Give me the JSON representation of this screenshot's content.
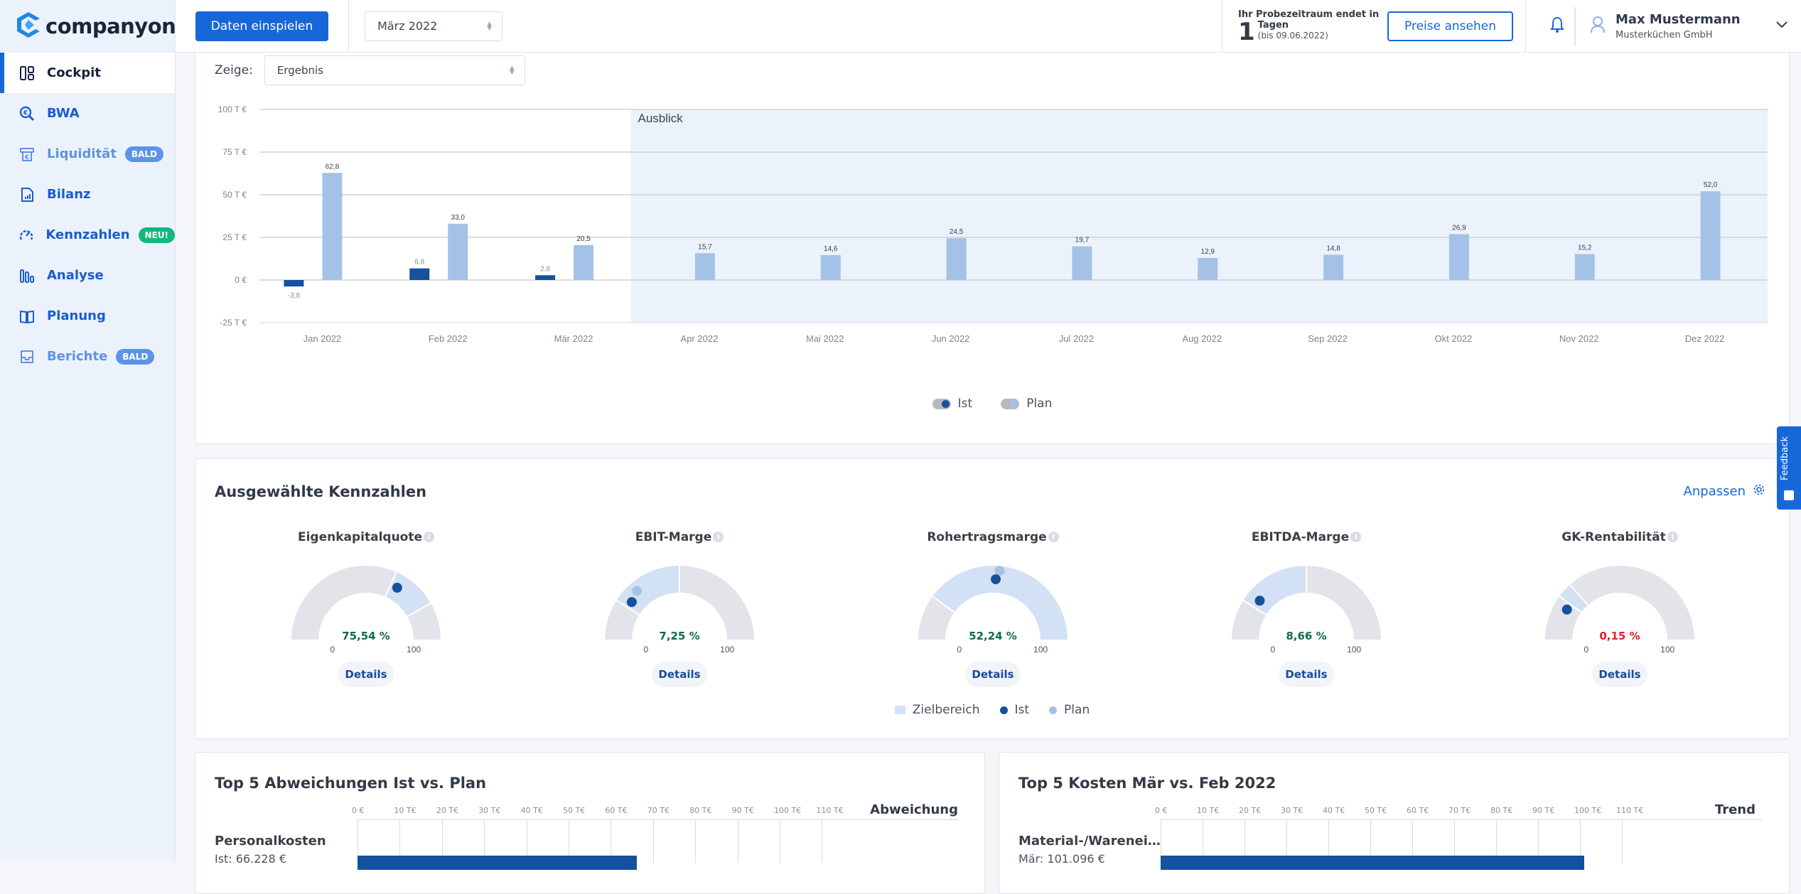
{
  "app": {
    "brand": "companyon",
    "colors": {
      "accent": "#1767d9",
      "ist": "#14519e",
      "plan": "#a4c2e8",
      "zielbereich": "#d3e1f4",
      "track": "#e3e4e9",
      "ok": "#116b49",
      "bad": "#e21d2c",
      "neu": "#12b77c",
      "bald": "#5d93e8"
    }
  },
  "sidebar": {
    "items": [
      {
        "label": "Cockpit",
        "icon": "dashboard-icon",
        "active": true
      },
      {
        "label": "BWA",
        "icon": "euro-search-icon"
      },
      {
        "label": "Liquidität",
        "icon": "cash-register-icon",
        "badge": "BALD",
        "muted": true
      },
      {
        "label": "Bilanz",
        "icon": "report-document-icon"
      },
      {
        "label": "Kennzahlen",
        "icon": "speedometer-icon",
        "badge": "NEU!"
      },
      {
        "label": "Analyse",
        "icon": "bar-chart-icon"
      },
      {
        "label": "Planung",
        "icon": "open-book-icon"
      },
      {
        "label": "Berichte",
        "icon": "inbox-tray-icon",
        "badge": "BALD",
        "muted": true
      }
    ]
  },
  "header": {
    "import_button": "Daten einspielen",
    "period_select": "März 2022",
    "trial": {
      "line1": "Ihr Probezeitraum endet in",
      "days": "1",
      "unit": "Tagen",
      "until": "(bis 09.06.2022)"
    },
    "prices_button": "Preise ansehen",
    "user": {
      "name": "Max Mustermann",
      "company": "Musterküchen GmbH"
    }
  },
  "result_chart": {
    "show_label": "Zeige:",
    "show_select": "Ergebnis",
    "outlook_label": "Ausblick",
    "legend": [
      {
        "label": "Ist"
      },
      {
        "label": "Plan"
      }
    ]
  },
  "chart_data": {
    "type": "bar",
    "title": "Ergebnis",
    "xlabel": "",
    "ylabel": "",
    "ylim": [
      -25,
      100
    ],
    "yticks": [
      100,
      75,
      50,
      25,
      0,
      -25
    ],
    "ytick_labels": [
      "100 T €",
      "75 T €",
      "50 T €",
      "25 T €",
      "0 €",
      "-25 T €"
    ],
    "grid": true,
    "legend_position": "bottom-center",
    "categories": [
      "Jan 2022",
      "Feb 2022",
      "Mär 2022",
      "Apr 2022",
      "Mai 2022",
      "Jun 2022",
      "Jul 2022",
      "Aug 2022",
      "Sep 2022",
      "Okt 2022",
      "Nov 2022",
      "Dez 2022"
    ],
    "series": [
      {
        "name": "Ist",
        "values": [
          -3.8,
          6.8,
          2.8,
          null,
          null,
          null,
          null,
          null,
          null,
          null,
          null,
          null
        ],
        "labels": [
          "-3,8",
          "6,8",
          "2,8",
          null,
          null,
          null,
          null,
          null,
          null,
          null,
          null,
          null
        ]
      },
      {
        "name": "Plan",
        "values": [
          62.8,
          33.0,
          20.5,
          15.7,
          14.6,
          24.5,
          19.7,
          12.9,
          14.8,
          26.9,
          15.2,
          52.0
        ],
        "labels": [
          "62,8",
          "33,0",
          "20,5",
          "15,7",
          "14,6",
          "24,5",
          "19,7",
          "12,9",
          "14,8",
          "26,9",
          "15,2",
          "52,0"
        ]
      }
    ],
    "annotations": [
      {
        "text": "Ausblick",
        "region_from_category": "Apr 2022",
        "region_to_category": "Dez 2022"
      }
    ]
  },
  "kennzahlen": {
    "title": "Ausgewählte Kennzahlen",
    "customize": "Anpassen",
    "details_label": "Details",
    "min_label": "0",
    "max_label": "100",
    "gauges": [
      {
        "title": "Eigenkapitalquote",
        "value_label": "75,54 %",
        "ist": 75.54,
        "plan": null,
        "target": [
          70,
          100
        ],
        "status": "ok"
      },
      {
        "title": "EBIT-Marge",
        "value_label": "7,25 %",
        "ist": 7.25,
        "plan": 10,
        "target": [
          2,
          50
        ],
        "status": "ok"
      },
      {
        "title": "Rohertragsmarge",
        "value_label": "52,24 %",
        "ist": 52.24,
        "plan": 53,
        "target": [
          5,
          125
        ],
        "status": "ok"
      },
      {
        "title": "EBITDA-Marge",
        "value_label": "8,66 %",
        "ist": 8.66,
        "plan": null,
        "target": [
          2,
          50
        ],
        "status": "ok"
      },
      {
        "title": "GK-Rentabilität",
        "value_label": "0,15 %",
        "ist": 0.15,
        "plan": null,
        "target": [
          5,
          15
        ],
        "status": "bad"
      }
    ],
    "legend": [
      "Zielbereich",
      "Ist",
      "Plan"
    ]
  },
  "top_deviations": {
    "title": "Top 5 Abweichungen Ist vs. Plan",
    "column_header": "Abweichung",
    "axis": [
      "0 €",
      "10 T€",
      "20 T€",
      "30 T€",
      "40 T€",
      "50 T€",
      "60 T€",
      "70 T€",
      "80 T€",
      "90 T€",
      "100 T€",
      "110 T€"
    ],
    "rows": [
      {
        "label": "Personalkosten",
        "sub": "Ist: 66.228 €",
        "value_k": 66.2
      }
    ]
  },
  "top_costs": {
    "title": "Top 5 Kosten Mär vs. Feb 2022",
    "column_header": "Trend",
    "axis": [
      "0 €",
      "10 T€",
      "20 T€",
      "30 T€",
      "40 T€",
      "50 T€",
      "60 T€",
      "70 T€",
      "80 T€",
      "90 T€",
      "100 T€",
      "110 T€"
    ],
    "rows": [
      {
        "label": "Material-/Warenei…",
        "sub": "Mär: 101.096 €",
        "value_k": 101.1
      }
    ]
  },
  "feedback": {
    "label": "Feedback"
  }
}
